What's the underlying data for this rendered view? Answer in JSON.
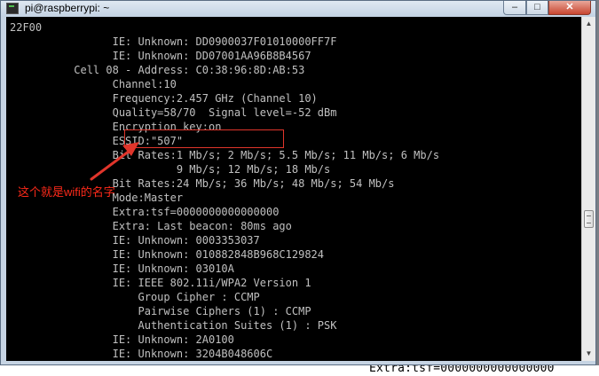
{
  "window": {
    "title": "pi@raspberrypi: ~",
    "buttons": {
      "minimize": "–",
      "maximize": "□",
      "close": "✕"
    }
  },
  "terminal": {
    "lines": [
      "22F00",
      "                IE: Unknown: DD0900037F01010000FF7F",
      "                IE: Unknown: DD07001AA96B8B4567",
      "          Cell 08 - Address: C0:38:96:8D:AB:53",
      "                Channel:10",
      "                Frequency:2.457 GHz (Channel 10)",
      "                Quality=58/70  Signal level=-52 dBm",
      "                Encryption key:on",
      "                ESSID:\"507\"",
      "                Bit Rates:1 Mb/s; 2 Mb/s; 5.5 Mb/s; 11 Mb/s; 6 Mb/s",
      "                          9 Mb/s; 12 Mb/s; 18 Mb/s",
      "                Bit Rates:24 Mb/s; 36 Mb/s; 48 Mb/s; 54 Mb/s",
      "                Mode:Master",
      "                Extra:tsf=0000000000000000",
      "                Extra: Last beacon: 80ms ago",
      "                IE: Unknown: 0003353037",
      "                IE: Unknown: 010882848B968C129824",
      "                IE: Unknown: 03010A",
      "                IE: IEEE 802.11i/WPA2 Version 1",
      "                    Group Cipher : CCMP",
      "                    Pairwise Ciphers (1) : CCMP",
      "                    Authentication Suites (1) : PSK",
      "                IE: Unknown: 2A0100",
      "                IE: Unknown: 3204B048606C"
    ]
  },
  "annotation": {
    "label": "这个就是wifi的名字",
    "color": "#ff2a1a"
  },
  "background_text": "Extra:tsf=0000000000000000"
}
